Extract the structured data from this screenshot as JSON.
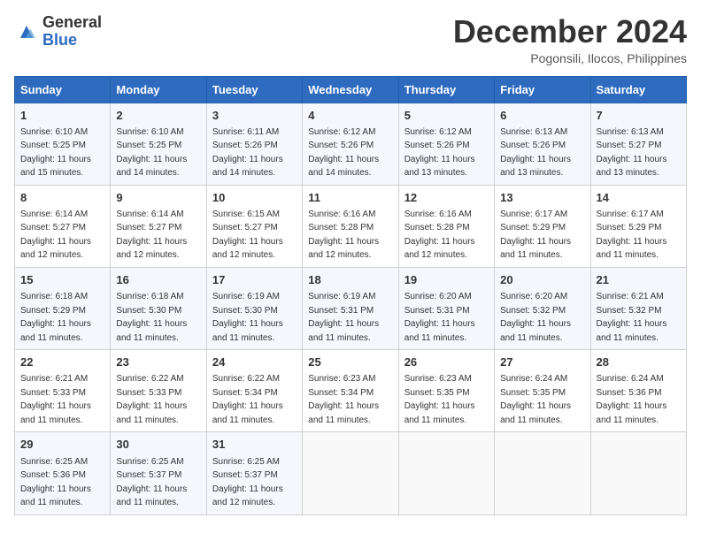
{
  "header": {
    "logo_general": "General",
    "logo_blue": "Blue",
    "month_title": "December 2024",
    "subtitle": "Pogonsili, Ilocos, Philippines"
  },
  "days_of_week": [
    "Sunday",
    "Monday",
    "Tuesday",
    "Wednesday",
    "Thursday",
    "Friday",
    "Saturday"
  ],
  "weeks": [
    [
      {
        "day": "1",
        "sunrise": "6:10 AM",
        "sunset": "5:25 PM",
        "daylight": "11 hours and 15 minutes."
      },
      {
        "day": "2",
        "sunrise": "6:10 AM",
        "sunset": "5:25 PM",
        "daylight": "11 hours and 14 minutes."
      },
      {
        "day": "3",
        "sunrise": "6:11 AM",
        "sunset": "5:26 PM",
        "daylight": "11 hours and 14 minutes."
      },
      {
        "day": "4",
        "sunrise": "6:12 AM",
        "sunset": "5:26 PM",
        "daylight": "11 hours and 14 minutes."
      },
      {
        "day": "5",
        "sunrise": "6:12 AM",
        "sunset": "5:26 PM",
        "daylight": "11 hours and 13 minutes."
      },
      {
        "day": "6",
        "sunrise": "6:13 AM",
        "sunset": "5:26 PM",
        "daylight": "11 hours and 13 minutes."
      },
      {
        "day": "7",
        "sunrise": "6:13 AM",
        "sunset": "5:27 PM",
        "daylight": "11 hours and 13 minutes."
      }
    ],
    [
      {
        "day": "8",
        "sunrise": "6:14 AM",
        "sunset": "5:27 PM",
        "daylight": "11 hours and 12 minutes."
      },
      {
        "day": "9",
        "sunrise": "6:14 AM",
        "sunset": "5:27 PM",
        "daylight": "11 hours and 12 minutes."
      },
      {
        "day": "10",
        "sunrise": "6:15 AM",
        "sunset": "5:27 PM",
        "daylight": "11 hours and 12 minutes."
      },
      {
        "day": "11",
        "sunrise": "6:16 AM",
        "sunset": "5:28 PM",
        "daylight": "11 hours and 12 minutes."
      },
      {
        "day": "12",
        "sunrise": "6:16 AM",
        "sunset": "5:28 PM",
        "daylight": "11 hours and 12 minutes."
      },
      {
        "day": "13",
        "sunrise": "6:17 AM",
        "sunset": "5:29 PM",
        "daylight": "11 hours and 11 minutes."
      },
      {
        "day": "14",
        "sunrise": "6:17 AM",
        "sunset": "5:29 PM",
        "daylight": "11 hours and 11 minutes."
      }
    ],
    [
      {
        "day": "15",
        "sunrise": "6:18 AM",
        "sunset": "5:29 PM",
        "daylight": "11 hours and 11 minutes."
      },
      {
        "day": "16",
        "sunrise": "6:18 AM",
        "sunset": "5:30 PM",
        "daylight": "11 hours and 11 minutes."
      },
      {
        "day": "17",
        "sunrise": "6:19 AM",
        "sunset": "5:30 PM",
        "daylight": "11 hours and 11 minutes."
      },
      {
        "day": "18",
        "sunrise": "6:19 AM",
        "sunset": "5:31 PM",
        "daylight": "11 hours and 11 minutes."
      },
      {
        "day": "19",
        "sunrise": "6:20 AM",
        "sunset": "5:31 PM",
        "daylight": "11 hours and 11 minutes."
      },
      {
        "day": "20",
        "sunrise": "6:20 AM",
        "sunset": "5:32 PM",
        "daylight": "11 hours and 11 minutes."
      },
      {
        "day": "21",
        "sunrise": "6:21 AM",
        "sunset": "5:32 PM",
        "daylight": "11 hours and 11 minutes."
      }
    ],
    [
      {
        "day": "22",
        "sunrise": "6:21 AM",
        "sunset": "5:33 PM",
        "daylight": "11 hours and 11 minutes."
      },
      {
        "day": "23",
        "sunrise": "6:22 AM",
        "sunset": "5:33 PM",
        "daylight": "11 hours and 11 minutes."
      },
      {
        "day": "24",
        "sunrise": "6:22 AM",
        "sunset": "5:34 PM",
        "daylight": "11 hours and 11 minutes."
      },
      {
        "day": "25",
        "sunrise": "6:23 AM",
        "sunset": "5:34 PM",
        "daylight": "11 hours and 11 minutes."
      },
      {
        "day": "26",
        "sunrise": "6:23 AM",
        "sunset": "5:35 PM",
        "daylight": "11 hours and 11 minutes."
      },
      {
        "day": "27",
        "sunrise": "6:24 AM",
        "sunset": "5:35 PM",
        "daylight": "11 hours and 11 minutes."
      },
      {
        "day": "28",
        "sunrise": "6:24 AM",
        "sunset": "5:36 PM",
        "daylight": "11 hours and 11 minutes."
      }
    ],
    [
      {
        "day": "29",
        "sunrise": "6:25 AM",
        "sunset": "5:36 PM",
        "daylight": "11 hours and 11 minutes."
      },
      {
        "day": "30",
        "sunrise": "6:25 AM",
        "sunset": "5:37 PM",
        "daylight": "11 hours and 11 minutes."
      },
      {
        "day": "31",
        "sunrise": "6:25 AM",
        "sunset": "5:37 PM",
        "daylight": "11 hours and 12 minutes."
      },
      null,
      null,
      null,
      null
    ]
  ],
  "labels": {
    "sunrise": "Sunrise:",
    "sunset": "Sunset:",
    "daylight": "Daylight:"
  }
}
